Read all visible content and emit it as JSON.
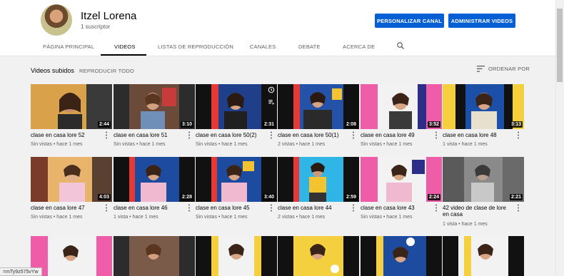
{
  "channel": {
    "name": "Itzel Lorena",
    "subscribers": "1 suscriptor",
    "customize_label": "PERSONALIZAR CANAL",
    "manage_label": "ADMINISTRAR VIDEOS"
  },
  "tabs": [
    {
      "label": "PÁGINA PRINCIPAL",
      "active": false
    },
    {
      "label": "VIDEOS",
      "active": true
    },
    {
      "label": "LISTAS DE REPRODUCCIÓN",
      "active": false
    },
    {
      "label": "CANALES",
      "active": false
    },
    {
      "label": "DEBATE",
      "active": false
    },
    {
      "label": "ACERCA DE",
      "active": false
    }
  ],
  "section": {
    "title": "Videos subidos",
    "play_all": "REPRODUCIR TODO",
    "sort_label": "ORDENAR POR"
  },
  "videos": [
    {
      "title": "clase en casa lore 52",
      "meta": "Sin vistas • hace 1 mes",
      "duration": "2:44"
    },
    {
      "title": "clase en casa lore 51",
      "meta": "Sin vistas • hace 1 mes",
      "duration": "3:10"
    },
    {
      "title": "clase en casa lore 50(2)",
      "meta": "Sin vistas • hace 1 mes",
      "duration": "2:31"
    },
    {
      "title": "clase en casa lore 50(1)",
      "meta": "2 vistas • hace 1 mes",
      "duration": "2:08"
    },
    {
      "title": "clase en casa lore 49",
      "meta": "Sin vistas • hace 1 mes",
      "duration": "3:52"
    },
    {
      "title": "clase en casa lore 48",
      "meta": "1 vista • hace 1 mes",
      "duration": "3:13"
    },
    {
      "title": "clase en casa lore 47",
      "meta": "Sin vistas • hace 1 mes",
      "duration": "4:03"
    },
    {
      "title": "clase en casa lore 46",
      "meta": "1 vista • hace 1 mes",
      "duration": "2:28"
    },
    {
      "title": "clase en casa lore 45",
      "meta": "Sin vistas • hace 1 mes",
      "duration": "3:40"
    },
    {
      "title": "clase en casa lore 44",
      "meta": "2 vistas • hace 1 mes",
      "duration": "2:59"
    },
    {
      "title": "clase en casa lore 43",
      "meta": "Sin vistas • hace 1 mes",
      "duration": "2:24"
    },
    {
      "title": "42 video de clase de lore en casa",
      "meta": "1 vista • hace 1 mes",
      "duration": "2:21"
    }
  ],
  "status_url": "=mTy9z575vYw",
  "colors": {
    "accent": "#065fd4",
    "background": "#f1f1f1"
  }
}
